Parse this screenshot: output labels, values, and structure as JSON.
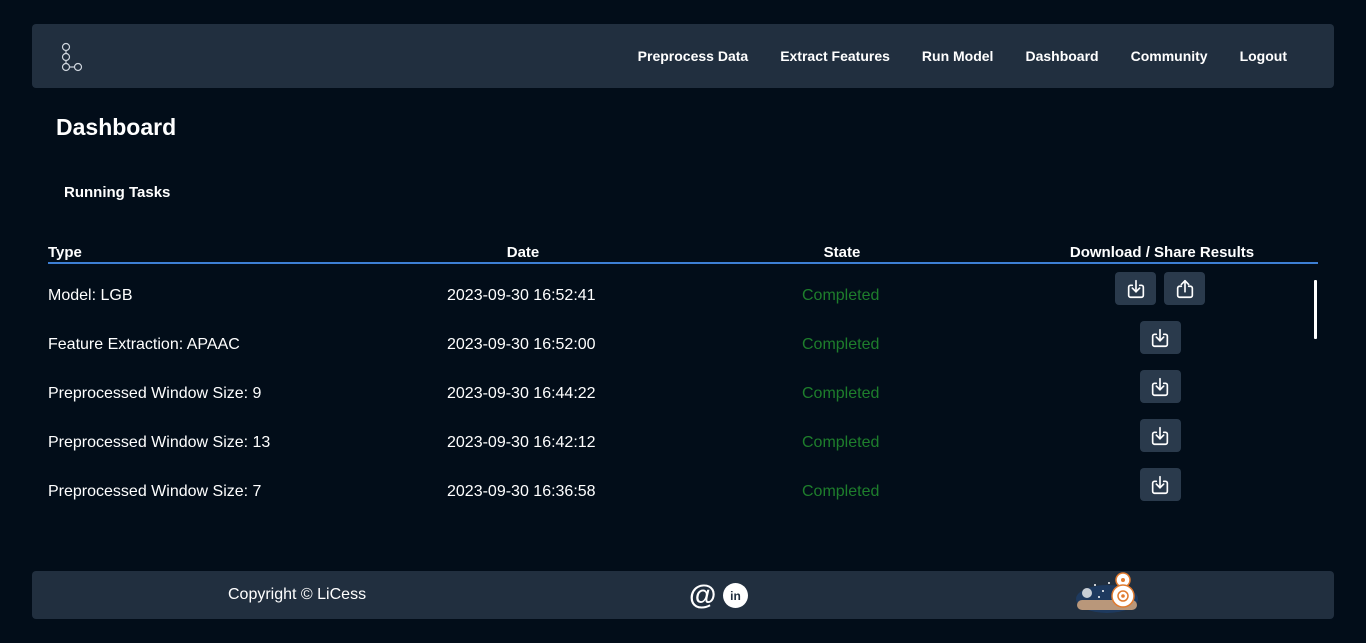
{
  "nav": {
    "logo_icon": "graph-nodes-logo",
    "links": [
      "Preprocess Data",
      "Extract Features",
      "Run Model",
      "Dashboard",
      "Community",
      "Logout"
    ]
  },
  "page": {
    "title": "Dashboard",
    "section_title": "Running Tasks"
  },
  "table": {
    "headers": [
      "Type",
      "Date",
      "State",
      "Download / Share Results"
    ],
    "rows": [
      {
        "type": "Model: LGB",
        "date": "2023-09-30 16:52:41",
        "state": "Completed",
        "actions": [
          "download-icon",
          "share-icon"
        ]
      },
      {
        "type": "Feature Extraction: APAAC",
        "date": "2023-09-30 16:52:00",
        "state": "Completed",
        "actions": [
          "download-icon"
        ]
      },
      {
        "type": "Preprocessed Window Size: 9",
        "date": "2023-09-30 16:44:22",
        "state": "Completed",
        "actions": [
          "download-icon"
        ]
      },
      {
        "type": "Preprocessed Window Size: 13",
        "date": "2023-09-30 16:42:12",
        "state": "Completed",
        "actions": [
          "download-icon"
        ]
      },
      {
        "type": "Preprocessed Window Size: 7",
        "date": "2023-09-30 16:36:58",
        "state": "Completed",
        "actions": [
          "download-icon"
        ]
      }
    ]
  },
  "footer": {
    "copyright": "Copyright © LiCess",
    "email_icon": "@",
    "linkedin_icon": "in",
    "mascot_icon": "robot-mascot-icon"
  },
  "colors": {
    "background": "#020d19",
    "panel": "#212f3f",
    "accent": "#3d7fd4",
    "status_completed": "#1e7e2c"
  }
}
